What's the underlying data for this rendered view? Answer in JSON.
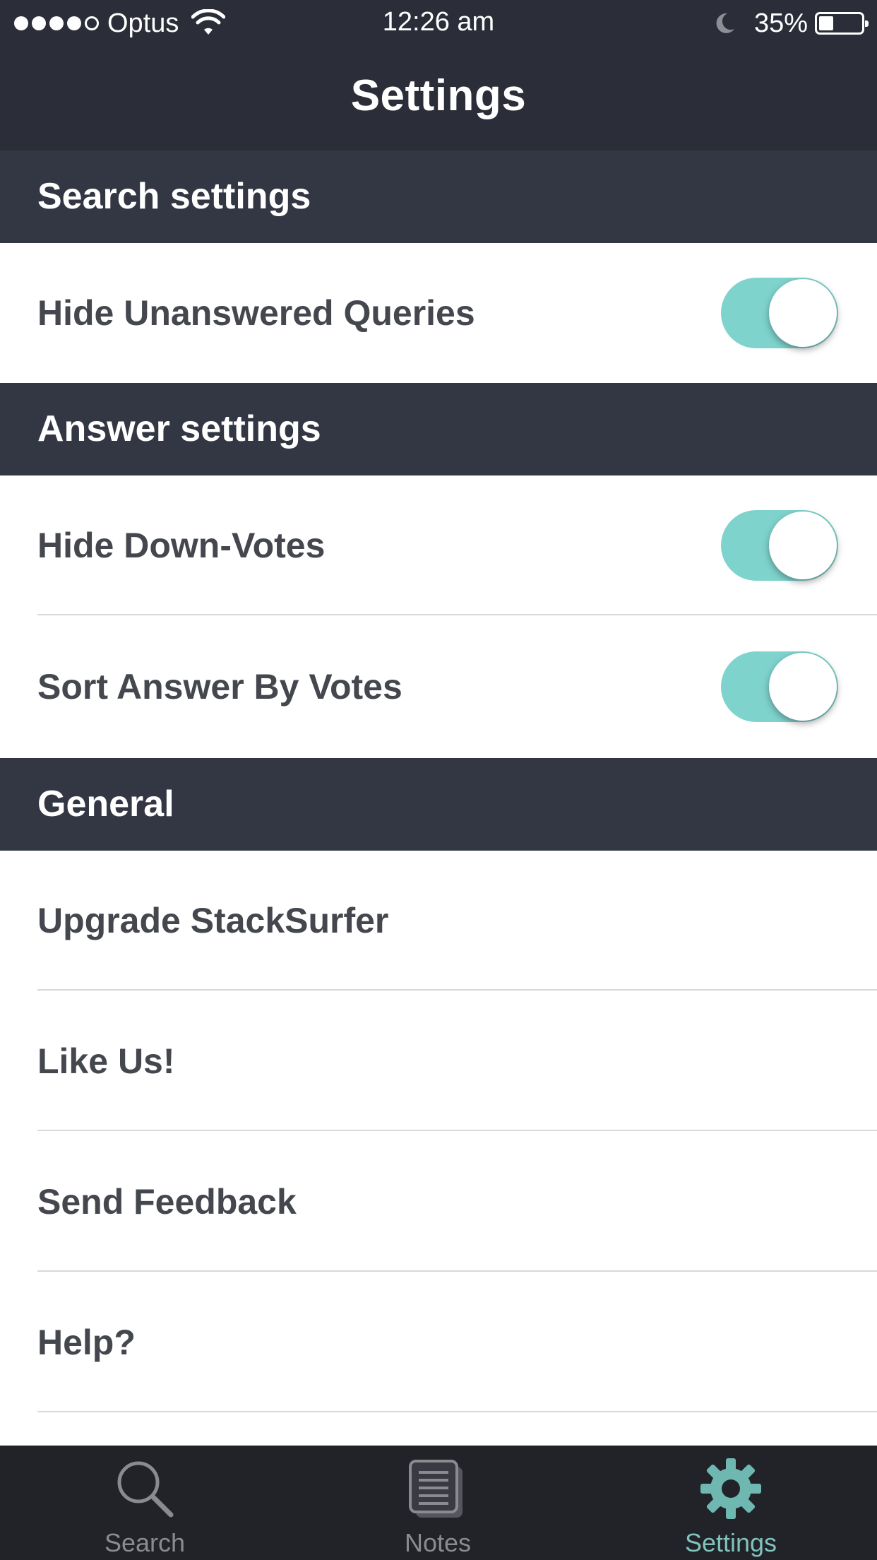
{
  "status_bar": {
    "signal_icon": "signal-dots-icon",
    "carrier": "Optus",
    "wifi_icon": "wifi-icon",
    "time": "12:26 am",
    "moon_icon": "do-not-disturb-moon-icon",
    "battery_percent": "35%",
    "battery_level": 0.35
  },
  "nav": {
    "title": "Settings"
  },
  "sections": {
    "search": {
      "header": "Search settings",
      "rows": [
        {
          "label": "Hide Unanswered Queries",
          "toggle_on": true
        }
      ]
    },
    "answer": {
      "header": "Answer settings",
      "rows": [
        {
          "label": "Hide Down-Votes",
          "toggle_on": true
        },
        {
          "label": "Sort Answer By Votes",
          "toggle_on": true
        }
      ]
    },
    "general": {
      "header": "General",
      "rows": [
        {
          "label": "Upgrade StackSurfer"
        },
        {
          "label": "Like Us!"
        },
        {
          "label": "Send Feedback"
        },
        {
          "label": "Help?"
        }
      ]
    }
  },
  "tab_bar": {
    "tabs": [
      {
        "label": "Search",
        "icon": "search-icon",
        "active": false
      },
      {
        "label": "Notes",
        "icon": "notes-icon",
        "active": false
      },
      {
        "label": "Settings",
        "icon": "gear-icon",
        "active": true
      }
    ]
  },
  "colors": {
    "header_bg": "#2b2e38",
    "section_bg": "#333744",
    "toggle_on": "#7fd3cd",
    "tab_active": "#7fc3bd",
    "tab_inactive": "#8a8b90",
    "row_text": "#44474e"
  }
}
